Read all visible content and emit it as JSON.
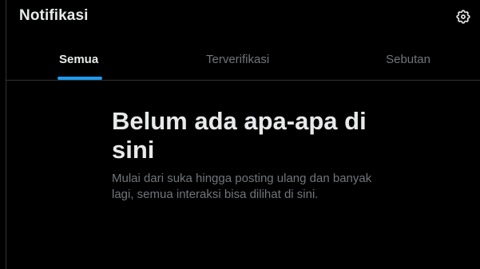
{
  "header": {
    "title": "Notifikasi",
    "settings_icon": "gear-icon"
  },
  "tabs": [
    {
      "label": "Semua",
      "active": true
    },
    {
      "label": "Terverifikasi",
      "active": false
    },
    {
      "label": "Sebutan",
      "active": false
    }
  ],
  "empty_state": {
    "title": "Belum ada apa-apa di sini",
    "description": "Mulai dari suka hingga posting ulang dan banyak lagi, semua interaksi bisa dilihat di sini."
  },
  "colors": {
    "background": "#000000",
    "text_primary": "#e7e9ea",
    "text_secondary": "#71767b",
    "accent": "#1d9bf0",
    "border": "#2f3336"
  }
}
